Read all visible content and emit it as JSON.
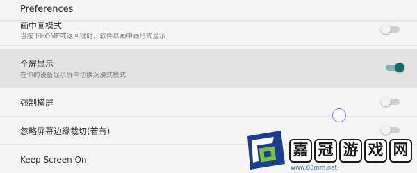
{
  "header": {
    "title": "Preferences"
  },
  "rows": [
    {
      "title": "画中画模式",
      "subtitle": "当按下HOME或返回键时，软件以画中画形式显示",
      "toggle_on": false
    },
    {
      "title": "全屏显示",
      "subtitle": "在你的设备显示屏中切换沉浸式模式",
      "toggle_on": true
    },
    {
      "title": "强制横屏",
      "toggle_on": false
    },
    {
      "title": "忽略屏幕边缘裁切(若有)",
      "toggle_on": false
    },
    {
      "title": "Keep Screen On"
    }
  ],
  "watermark": {
    "chars": [
      "嘉",
      "冠",
      "游",
      "戏",
      "网"
    ],
    "url": "www.03mm.net"
  },
  "colors": {
    "accent": "#0f6b69",
    "selected_row": "#e3e3e3",
    "background": "#f5f5f5"
  }
}
